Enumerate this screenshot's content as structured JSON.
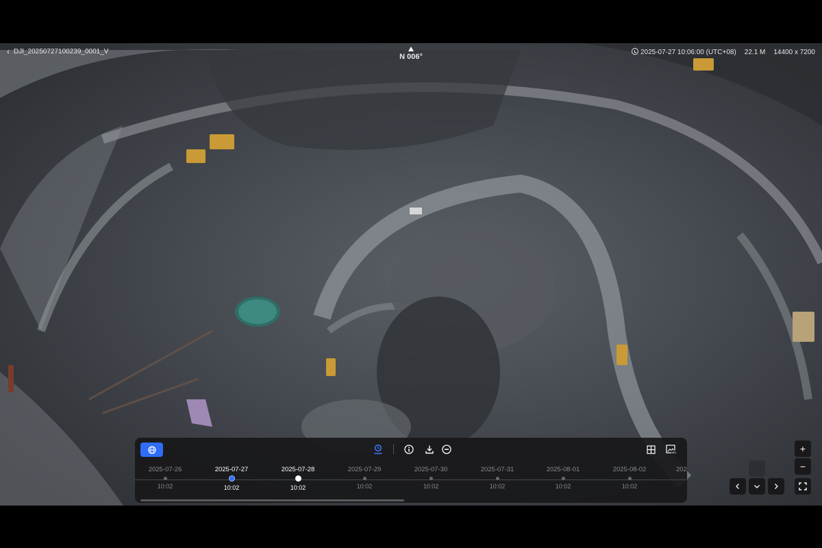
{
  "header": {
    "back_icon": "chevron-left-icon",
    "file_name": "DJI_20250727100239_0001_V",
    "heading": "N 006°",
    "timestamp": "2025-07-27 10:06:00 (UTC+08)",
    "file_size": "22.1 M",
    "resolution": "14400 x 7200"
  },
  "toolbar": {
    "globe_icon": "globe-icon",
    "location_pin_icon": "location-pin-icon",
    "info_icon": "info-icon",
    "download_icon": "download-icon",
    "remove_icon": "minus-circle-icon",
    "grid_icon": "grid-view-icon",
    "image_new_icon": "image-new-icon",
    "accent_color": "#2f6df6"
  },
  "timeline": {
    "ticks": [
      {
        "date": "2025-07-26",
        "time": "10:02",
        "state": "normal"
      },
      {
        "date": "2025-07-27",
        "time": "10:02",
        "state": "active"
      },
      {
        "date": "2025-07-28",
        "time": "10:02",
        "state": "current"
      },
      {
        "date": "2025-07-29",
        "time": "10:02",
        "state": "normal"
      },
      {
        "date": "2025-07-30",
        "time": "10:02",
        "state": "normal"
      },
      {
        "date": "2025-07-31",
        "time": "10:02",
        "state": "normal"
      },
      {
        "date": "2025-08-01",
        "time": "10:02",
        "state": "normal"
      },
      {
        "date": "2025-08-02",
        "time": "10:02",
        "state": "normal"
      },
      {
        "date": "202",
        "time": "",
        "state": "normal"
      }
    ]
  },
  "map_controls": {
    "zoom_in": "+",
    "zoom_out": "−",
    "fullscreen_icon": "fullscreen-icon",
    "pan_up_icon": "chevron-up-icon",
    "pan_left_icon": "chevron-left-icon",
    "pan_down_icon": "chevron-down-icon",
    "pan_right_icon": "chevron-right-icon"
  }
}
